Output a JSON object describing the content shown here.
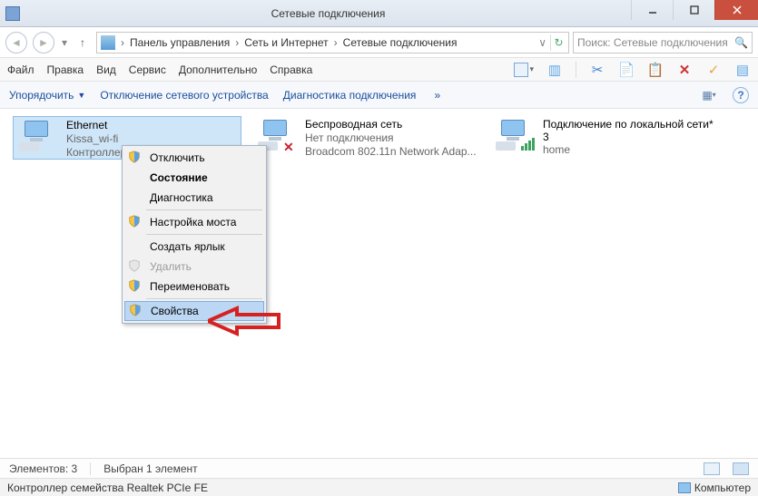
{
  "window": {
    "title": "Сетевые подключения"
  },
  "breadcrumbs": {
    "items": [
      "Панель управления",
      "Сеть и Интернет",
      "Сетевые подключения"
    ]
  },
  "search": {
    "placeholder": "Поиск: Сетевые подключения"
  },
  "menu": {
    "file": "Файл",
    "edit": "Правка",
    "view": "Вид",
    "service": "Сервис",
    "extra": "Дополнительно",
    "help": "Справка"
  },
  "commandbar": {
    "organize": "Упорядочить",
    "disable": "Отключение сетевого устройства",
    "diagnose": "Диагностика подключения"
  },
  "connections": [
    {
      "name": "Ethernet",
      "line2": "Kissa_wi-fi",
      "line3": "Контроллер"
    },
    {
      "name": "Беспроводная сеть",
      "line2": "Нет подключения",
      "line3": "Broadcom 802.11n Network Adap..."
    },
    {
      "name": "Подключение по локальной сети* 3",
      "line2": "",
      "line3": "home"
    }
  ],
  "context_menu": {
    "items": [
      "Отключить",
      "Состояние",
      "Диагностика",
      "Настройка моста",
      "Создать ярлык",
      "Удалить",
      "Переименовать",
      "Свойства"
    ]
  },
  "status": {
    "elements_label": "Элементов:",
    "elements_count": "3",
    "selected_label": "Выбран 1 элемент",
    "detail": "Контроллер семейства Realtek PCIe FE",
    "computer": "Компьютер"
  }
}
